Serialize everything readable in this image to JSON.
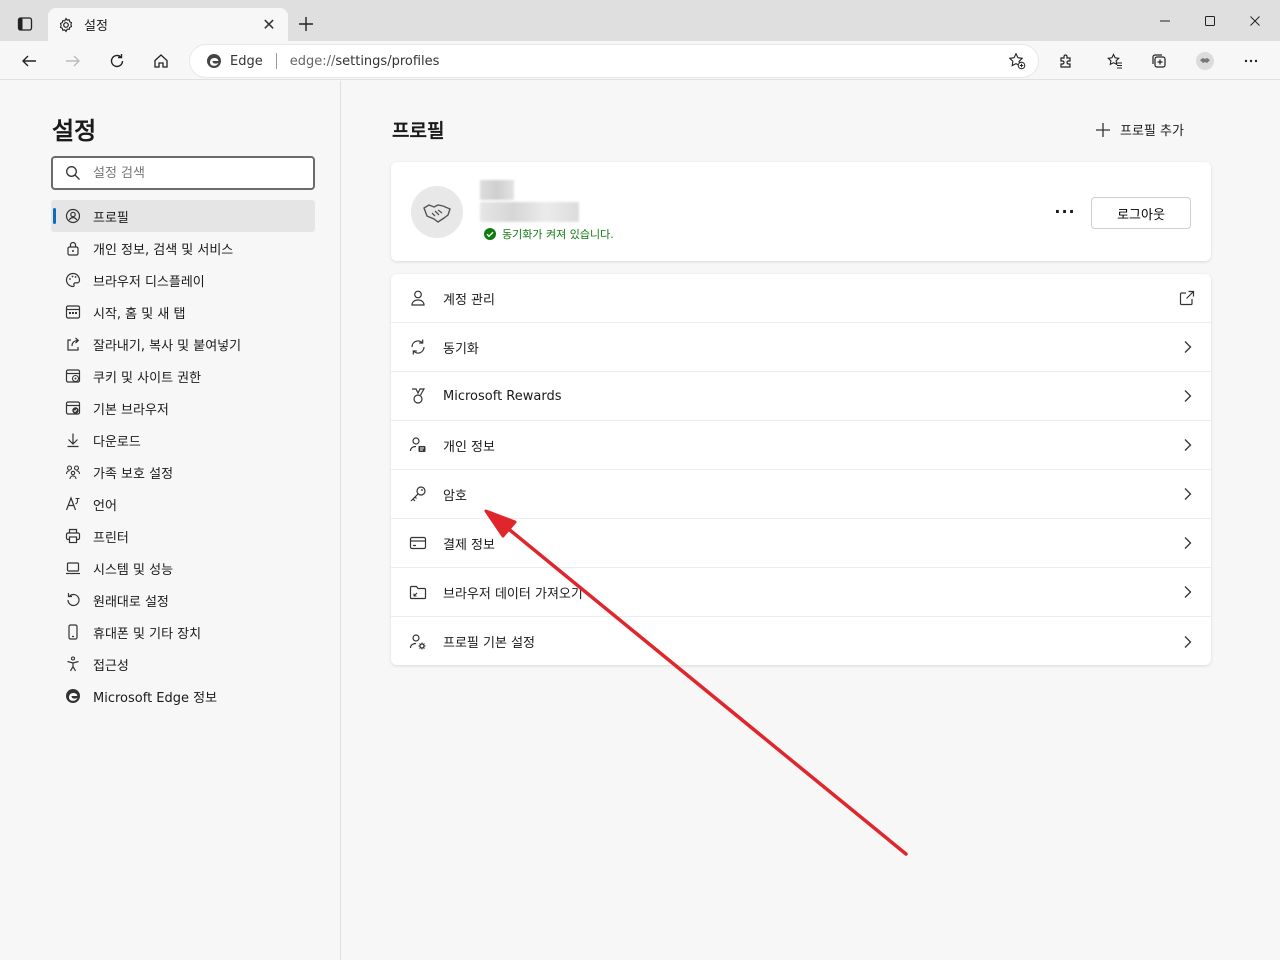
{
  "tab": {
    "title": "설정",
    "icon": "gear-icon"
  },
  "window_controls": [
    "minimize-icon",
    "maximize-icon",
    "close-icon"
  ],
  "address": {
    "chip": "Edge",
    "url_host": "edge://",
    "url_path": "settings/profiles"
  },
  "sidebar": {
    "title": "설정",
    "search_placeholder": "설정 검색",
    "items": [
      {
        "label": "프로필",
        "icon": "profile-icon"
      },
      {
        "label": "개인 정보, 검색 및 서비스",
        "icon": "lock-icon"
      },
      {
        "label": "브라우저 디스플레이",
        "icon": "palette-icon"
      },
      {
        "label": "시작, 홈 및 새 탭",
        "icon": "home-grid-icon"
      },
      {
        "label": "잘라내기, 복사 및 붙여넣기",
        "icon": "share-icon"
      },
      {
        "label": "쿠키 및 사이트 권한",
        "icon": "cookie-icon"
      },
      {
        "label": "기본 브라우저",
        "icon": "default-browser-icon"
      },
      {
        "label": "다운로드",
        "icon": "download-icon"
      },
      {
        "label": "가족 보호 설정",
        "icon": "family-icon"
      },
      {
        "label": "언어",
        "icon": "language-icon"
      },
      {
        "label": "프린터",
        "icon": "printer-icon"
      },
      {
        "label": "시스템 및 성능",
        "icon": "laptop-icon"
      },
      {
        "label": "원래대로 설정",
        "icon": "reset-icon"
      },
      {
        "label": "휴대폰 및 기타 장치",
        "icon": "phone-icon"
      },
      {
        "label": "접근성",
        "icon": "accessibility-icon"
      },
      {
        "label": "Microsoft Edge 정보",
        "icon": "edge-icon"
      }
    ]
  },
  "main": {
    "title": "프로필",
    "add_profile": "프로필 추가",
    "profile": {
      "sync_status": "동기화가 켜져 있습니다.",
      "more": "···",
      "logout": "로그아웃"
    },
    "rows": [
      {
        "label": "계정 관리",
        "icon": "person-icon",
        "trail": "external-link-icon"
      },
      {
        "label": "동기화",
        "icon": "sync-icon",
        "trail": "chevron-right-icon"
      },
      {
        "label": "Microsoft Rewards",
        "icon": "medal-icon",
        "trail": "chevron-right-icon"
      },
      {
        "label": "개인 정보",
        "icon": "person-card-icon",
        "trail": "chevron-right-icon"
      },
      {
        "label": "암호",
        "icon": "key-icon",
        "trail": "chevron-right-icon"
      },
      {
        "label": "결제 정보",
        "icon": "credit-card-icon",
        "trail": "chevron-right-icon"
      },
      {
        "label": "브라우저 데이터 가져오기",
        "icon": "import-icon",
        "trail": "chevron-right-icon"
      },
      {
        "label": "프로필 기본 설정",
        "icon": "person-settings-icon",
        "trail": "chevron-right-icon"
      }
    ]
  },
  "annotation": {
    "color": "#e0262c"
  }
}
